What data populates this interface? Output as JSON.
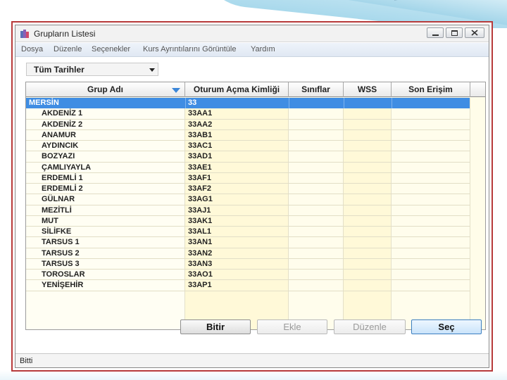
{
  "window": {
    "title": "Grupların Listesi"
  },
  "menu": [
    "Dosya",
    "Düzenle",
    "Seçenekler",
    "Kurs Ayrıntılarını Görüntüle",
    "Yardım"
  ],
  "filter": {
    "selected": "Tüm Tarihler"
  },
  "table": {
    "columns": [
      "Grup Adı",
      "Oturum Açma Kimliği",
      "Sınıflar",
      "WSS",
      "Son Erişim"
    ],
    "rows": [
      {
        "name": "MERSİN",
        "login": "33",
        "selected": true
      },
      {
        "name": "AKDENİZ 1",
        "login": "33AA1"
      },
      {
        "name": "AKDENİZ 2",
        "login": "33AA2"
      },
      {
        "name": "ANAMUR",
        "login": "33AB1"
      },
      {
        "name": "AYDINCIK",
        "login": "33AC1"
      },
      {
        "name": "BOZYAZI",
        "login": "33AD1"
      },
      {
        "name": "ÇAMLIYAYLA",
        "login": "33AE1"
      },
      {
        "name": "ERDEMLİ 1",
        "login": "33AF1"
      },
      {
        "name": "ERDEMLİ 2",
        "login": "33AF2"
      },
      {
        "name": "GÜLNAR",
        "login": "33AG1"
      },
      {
        "name": "MEZİTLİ",
        "login": "33AJ1"
      },
      {
        "name": "MUT",
        "login": "33AK1"
      },
      {
        "name": "SİLİFKE",
        "login": "33AL1"
      },
      {
        "name": "TARSUS 1",
        "login": "33AN1"
      },
      {
        "name": "TARSUS 2",
        "login": "33AN2"
      },
      {
        "name": "TARSUS 3",
        "login": "33AN3"
      },
      {
        "name": "TOROSLAR",
        "login": "33AO1"
      },
      {
        "name": "YENİŞEHİR",
        "login": "33AP1"
      }
    ]
  },
  "buttons": {
    "finish": "Bitir",
    "add": "Ekle",
    "edit": "Düzenle",
    "select": "Seç"
  },
  "status": {
    "text": "Bitti"
  },
  "colors": {
    "selection": "#3f8de3",
    "grid_background": "#fffde9",
    "frame_border": "#b73a3a"
  }
}
